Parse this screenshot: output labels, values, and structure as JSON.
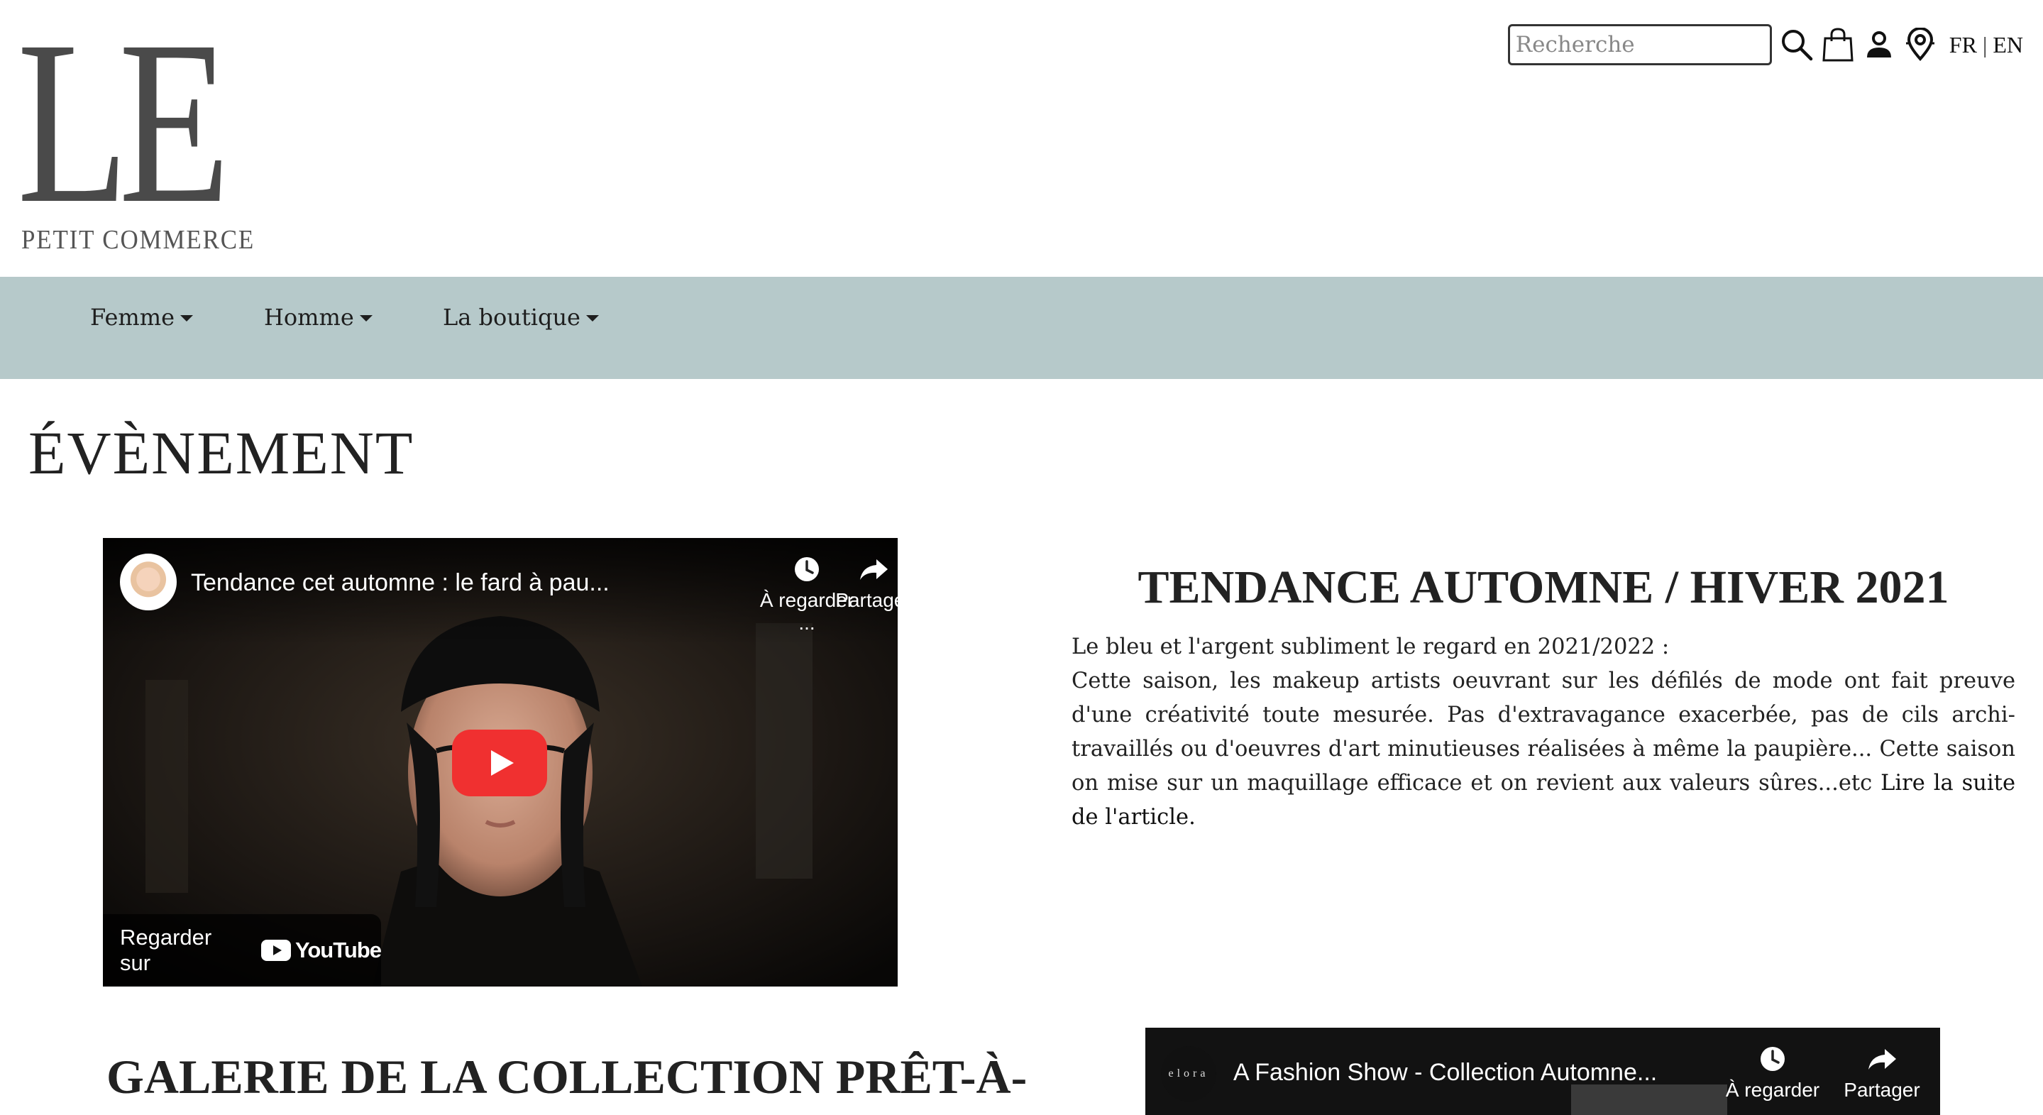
{
  "header": {
    "logo": {
      "letters": "LE",
      "tagline": "PETIT COMMERCE"
    },
    "search": {
      "placeholder": "Recherche",
      "value": ""
    },
    "icons": [
      "search-icon",
      "shopping-bag-icon",
      "user-icon",
      "store-locator-icon"
    ],
    "lang": {
      "fr": "FR",
      "separator": "|",
      "en": "EN"
    }
  },
  "nav": {
    "items": [
      {
        "label": "Femme"
      },
      {
        "label": "Homme"
      },
      {
        "label": "La boutique"
      }
    ],
    "background": "#b6c9ca"
  },
  "main": {
    "page_title": "ÉVÈNEMENT",
    "video1": {
      "title": "Tendance cet automne : le fard à pau...",
      "watch_later": "À regarder ...",
      "share": "Partager",
      "watch_on": "Regarder sur",
      "platform": "YouTube"
    },
    "article": {
      "title": "TENDANCE AUTOMNE / HIVER 2021",
      "lead": "Le bleu et l'argent subliment le regard en 2021/2022 :",
      "body": "Cette saison, les makeup artists oeuvrant sur les défilés de mode ont fait preuve d'une créativité toute mesurée. Pas d'extravagance exacerbée, pas de cils archi-travaillés ou d'oeuvres d'art minutieuses réalisées à même la paupière... Cette saison on mise sur un maquillage efficace et on revient aux valeurs sûres...etc ",
      "link": "Lire la suite de l'article."
    },
    "gallery_title": "GALERIE DE LA COLLECTION PRÊT-À-",
    "video2": {
      "brand": "elora",
      "title": "A Fashion Show - Collection Automne...",
      "watch_later": "À regarder ...",
      "share": "Partager"
    }
  },
  "colors": {
    "youtube_red": "#f03030",
    "nav_bg": "#b6c9ca"
  }
}
